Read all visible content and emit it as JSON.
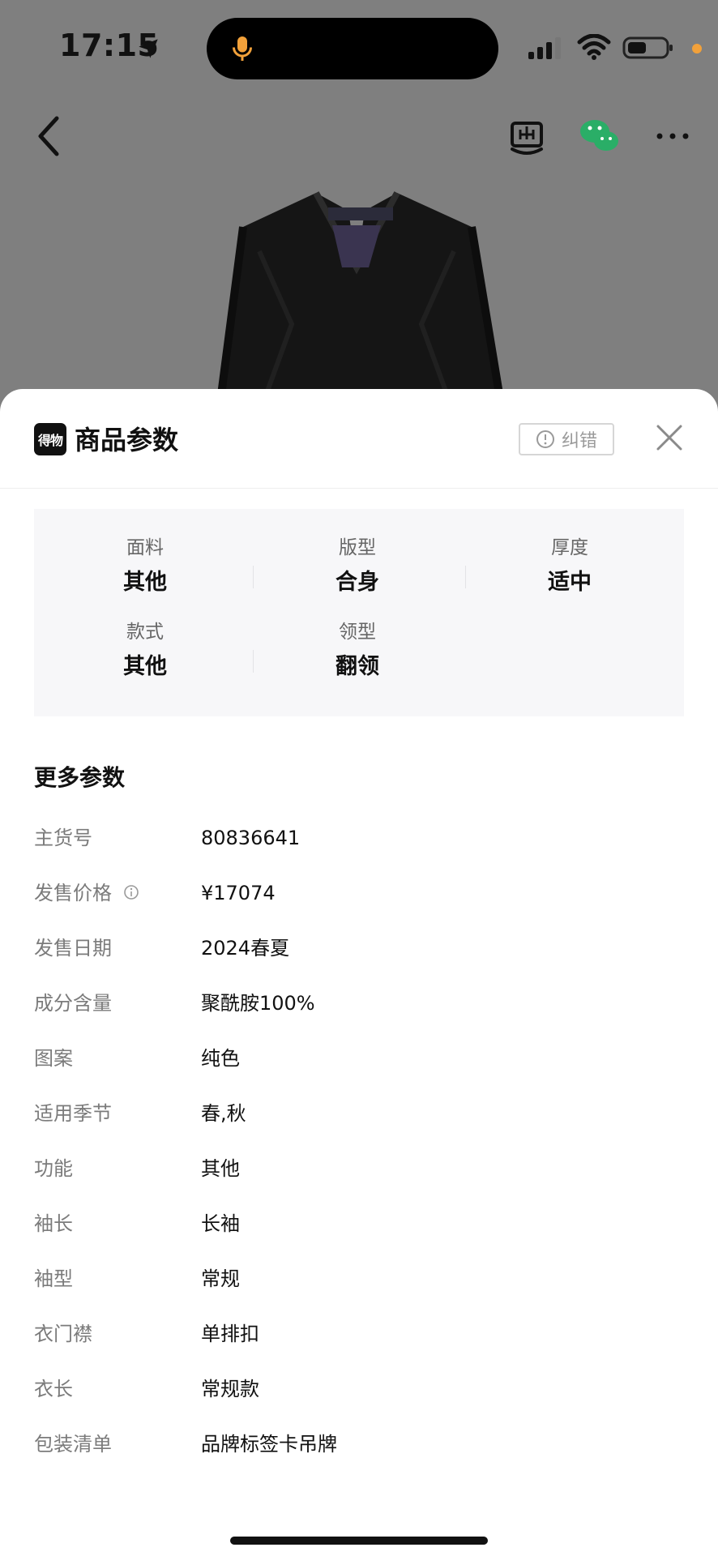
{
  "status_bar": {
    "time": "17:15"
  },
  "top_nav": {
    "icons": [
      "back-icon",
      "sell-icon",
      "wechat-icon",
      "more-icon"
    ]
  },
  "sheet": {
    "brand_logo_text": "得物",
    "title": "商品参数",
    "report_label": "纠错",
    "key_params": [
      {
        "label": "面料",
        "value": "其他"
      },
      {
        "label": "版型",
        "value": "合身"
      },
      {
        "label": "厚度",
        "value": "适中"
      },
      {
        "label": "款式",
        "value": "其他"
      },
      {
        "label": "领型",
        "value": "翻领"
      }
    ],
    "more_title": "更多参数",
    "specs": [
      {
        "key": "主货号",
        "value": "80836641"
      },
      {
        "key": "发售价格",
        "value": "¥17074"
      },
      {
        "key": "发售日期",
        "value": "2024春夏"
      },
      {
        "key": "成分含量",
        "value": "聚酰胺100%"
      },
      {
        "key": "图案",
        "value": "纯色"
      },
      {
        "key": "适用季节",
        "value": "春,秋"
      },
      {
        "key": "功能",
        "value": "其他"
      },
      {
        "key": "袖长",
        "value": "长袖"
      },
      {
        "key": "袖型",
        "value": "常规"
      },
      {
        "key": "衣门襟",
        "value": "单排扣"
      },
      {
        "key": "衣长",
        "value": "常规款"
      },
      {
        "key": "包装清单",
        "value": "品牌标签卡吊牌"
      }
    ]
  },
  "colors": {
    "overlay": "#7f7f7f",
    "sheet_bg": "#ffffff",
    "param_bg": "#f7f7f9",
    "muted_text": "#7b7b7b",
    "accent_orange": "#f2a13a",
    "wechat_green": "#2aae67"
  }
}
